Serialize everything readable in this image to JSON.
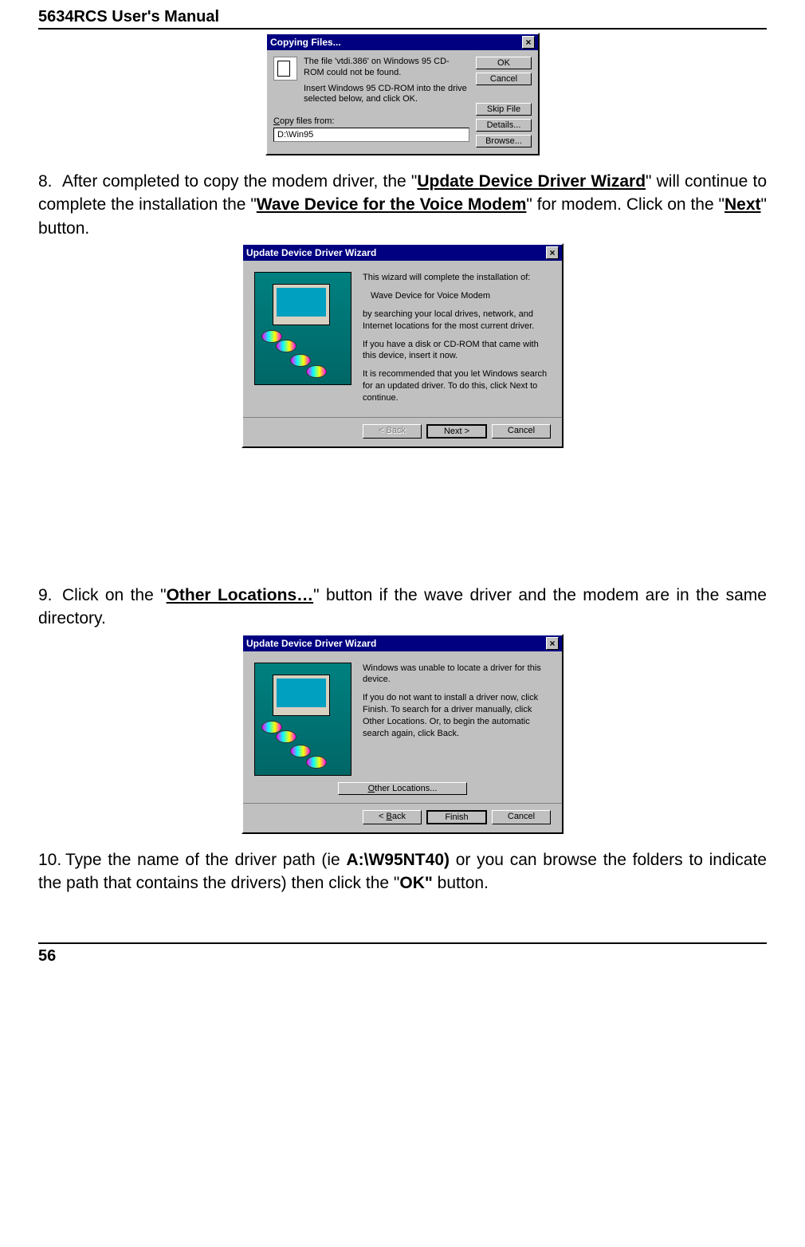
{
  "header": {
    "title": "5634RCS User's Manual"
  },
  "step8": {
    "num": "8.",
    "text1_a": "After completed to copy the modem driver, the \"",
    "bold1": "Update Device Driver Wizard",
    "text1_b": "\" will continue to complete the installation the \"",
    "bold2": "Wave Device for the Voice Modem",
    "text1_c": "\" for modem. Click on the \"",
    "bold3": "Next",
    "text1_d": "\" button."
  },
  "step9": {
    "num": "9.",
    "text_a": "Click on the \"",
    "bold1": "Other Locations…",
    "text_b": "\" button if the wave driver and the modem are in the same directory."
  },
  "step10": {
    "num": "10.",
    "text_a": "Type the name of the driver path (ie ",
    "bold1": "A:\\W95NT40)",
    "text_b": " or you can browse the folders to indicate the path that contains the drivers) then click the \"",
    "bold2": "OK\"",
    "text_c": " button."
  },
  "dlg1": {
    "title": "Copying Files...",
    "msg_l1": "The file 'vtdi.386' on Windows 95 CD-ROM could not be found.",
    "msg_l2": "Insert Windows 95 CD-ROM into the drive selected below, and click OK.",
    "copy_label": "Copy files from:",
    "path_value": "D:\\Win95",
    "btn_ok": "OK",
    "btn_cancel": "Cancel",
    "btn_skip": "Skip File",
    "btn_details": "Details...",
    "btn_browse": "Browse..."
  },
  "dlg2": {
    "title": "Update Device Driver Wizard",
    "p1": "This wizard will complete the installation of:",
    "p2": "Wave Device for Voice Modem",
    "p3": "by searching your local drives, network, and Internet locations for the most current driver.",
    "p4": "If you have a disk or CD-ROM that came with this device, insert it now.",
    "p5": "It is recommended that you let Windows search for an updated driver. To do this, click Next to continue.",
    "btn_back": "< Back",
    "btn_next": "Next >",
    "btn_cancel": "Cancel"
  },
  "dlg3": {
    "title": "Update Device Driver Wizard",
    "p1": "Windows was unable to locate a driver for this device.",
    "p2": "If you do not want to install a driver now, click Finish. To search for a driver manually, click Other Locations. Or, to begin the automatic search again, click Back.",
    "btn_other": "Other Locations...",
    "btn_back": "< Back",
    "btn_finish": "Finish",
    "btn_cancel": "Cancel"
  },
  "footer": {
    "pagenum": "56"
  }
}
